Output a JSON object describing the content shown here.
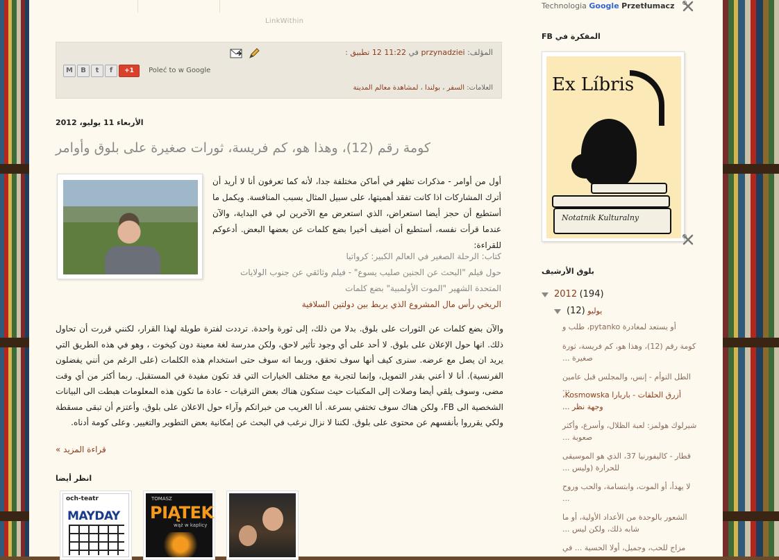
{
  "top": {
    "linkwithin": "LinkWithin"
  },
  "post_footer": {
    "author_label": "المؤلف:",
    "author": "przynadziei",
    "at": "في",
    "time": "11:22",
    "date_link": "12 تطبيق",
    "sep": ":",
    "share_text": "Poleć to w Google",
    "share_buttons": [
      "M",
      "B",
      "t",
      "f",
      "+1"
    ],
    "labels_label": "العلامات:",
    "labels": [
      "السفر",
      "بولندا",
      "لمشاهدة معالم المدينة"
    ]
  },
  "post": {
    "date": "الأربعاء 11 يوليو، 2012",
    "title": "كومة رقم (12)، وهذا هو، كم فريسة، ثورات صغيرة على بلوق وأوامر",
    "intro": "أول من أوامر - مذكرات تظهر في أماكن مختلفة جدا، لأنه كما تعرفون أنا لا أريد أن أترك المشاركات اذا كانت تفقد أهميتها، على سبيل المثال بسبب المنافسة. ويكمل ما أستطيع أن حجز أيضا استعراض، الذي استعرض مع الآخرين لي في البداية، والآن عندما قرأت نفسه، أستطيع أن أضيف أخيرا بضع كلمات عن بعضها البعض. أدعوكم للقراءة:",
    "links": [
      "كتاب: الرحلة الصغير في العالم الكبير: كرواتيا",
      "حول فيلم \"البحث عن الجنين صليب يسوع\" - فيلم وثائقي عن جنوب الولايات المتحدة الشهير \"الموت الأولمبية\" بضع كلمات",
      "الريخي رأس مال المشروع الذي يربط بين دولتين السلافية"
    ],
    "body": "والآن بضع كلمات عن الثورات على بلوق. بدلا من ذلك، إلى ثورة واحدة. ترددت لفترة طويلة لهذا القرار، لكنني قررت أن تحاول ذلك. انها حول الإعلان على بلوق. لا أحد على أي وجود تأثير لاحق، ولكن مدرسة لغة معينة دون كيخوت ، وهو في هذه الطريق التي يريد ان يصل مع عرضه. سنرى كيف أنها سوف تحقق، وربما انه سوف حتى استخدام هذه الكلمات (على الرغم من أنني يفضلون الفرنسية). أنا لا أعني بقدر التمويل، وإنما لتجربة مع مختلف الخيارات التي قد تكون مفيدة في المستقبل. ربما أكثر من أي وقت مضى، وسوف يلقي أيضا وصلات إلى المكتبات حيث ستكون هناك بعض الترقيات - عادة ما تكون هذه المعلومات هبطت الى البيانات الشخصية الى FB، ولكن هناك سوف تختفي بسرعة. أنا الغريب من خبراتكم وآراء حول الاعلان على بلوق. وأعتزم أن تبقى مسقطة ولكي يقرروا بأنفسهم عن محتوى على بلوق. لكننا لا نزال نرغب في البحث عن إمكانية بعض التطوير والتغيير. وعلى كومة أدناه.",
    "read_more": "قراءة المزيد »",
    "see_also": "انظر أيضا"
  },
  "thumbs": [
    {
      "top": "och-teatr",
      "title": "MAYDAY"
    },
    {
      "top": "TOMASZ",
      "title": "PIĄTEK",
      "sub": "wąż w kaplicy"
    },
    {
      "top": "",
      "title": ""
    }
  ],
  "sidebar": {
    "translate": {
      "prefix": "Technologia",
      "google": "Google",
      "suffix": "Przetłumacz"
    },
    "fb_title": "المفكرة في FB",
    "exlibris": {
      "title": "Ex Líbris",
      "sub": "Notatnik Kulturalny"
    },
    "archive_title": "بلوق الأرشيف",
    "archive": {
      "year": "2012",
      "year_count": "(194)",
      "month": "يوليو",
      "month_count": "(12)",
      "entries": [
        "أو يستعد لمغادرة pytanko، طلب و",
        "كومة رقم (12)، وهذا هو، كم فريسة، ثورة صغيرة ...",
        "الطل التوأم - إنس، والمجلس قبل عامين ...",
        "أزرق الحلقات - باربارا Kosmowska، وجهة نظر ...",
        "شيرلوك هولمز: لعبة الظلال، وأسرع، وأكثر صعوبة ...",
        "قطار - كاليفورنيا 37، الذي هو الموسيقى للحرارة (وليس ...",
        "لا يهدأ، أو الموت، وابتسامة، والحب وروح ...",
        "الشعور بالوحدة من الأعداد الأولية، أو ما شابه ذلك، ولكن ليس ...",
        "مزاج للحب، وجميل، أولا الحسية ... في"
      ]
    }
  }
}
